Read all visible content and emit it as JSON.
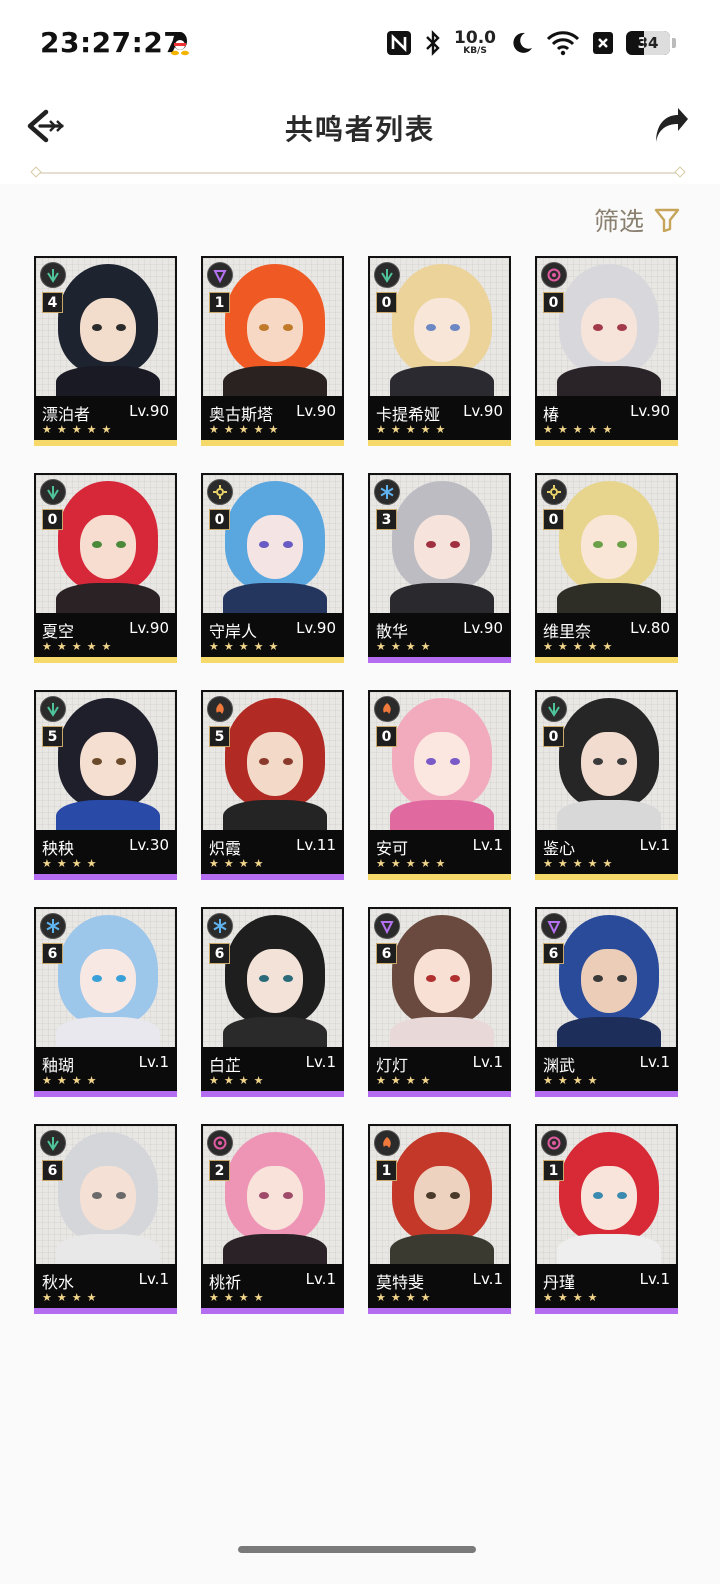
{
  "status_bar": {
    "time": "23:27:27",
    "net_speed_value": "10.0",
    "net_speed_unit": "KB/S",
    "battery": "34"
  },
  "header": {
    "title": "共鸣者列表",
    "back_icon": "back-arrow-icon",
    "share_icon": "share-icon"
  },
  "filter": {
    "label": "筛选",
    "icon": "filter-icon"
  },
  "colors": {
    "gold": "#f5d96a",
    "purple": "#b46cf0",
    "aero": "#4fc49a",
    "electro": "#b472f0",
    "glacio": "#5fb3f0",
    "spectro": "#e8d36a",
    "fusion": "#f07a3c",
    "havoc": "#e05aa0"
  },
  "characters": [
    {
      "name": "漂泊者",
      "level": "Lv.90",
      "chain": "4",
      "stars": "★★★★★",
      "rarity": "gold",
      "element": "aero",
      "hair": "#1e2330",
      "skin": "#f2dccb",
      "outfit": "#1a1a24",
      "eye": "#2b2b2b"
    },
    {
      "name": "奥古斯塔",
      "level": "Lv.90",
      "chain": "1",
      "stars": "★★★★★",
      "rarity": "gold",
      "element": "electro",
      "hair": "#ef5a24",
      "skin": "#f6d8c4",
      "outfit": "#2a2220",
      "eye": "#c07b2a"
    },
    {
      "name": "卡提希娅",
      "level": "Lv.90",
      "chain": "0",
      "stars": "★★★★★",
      "rarity": "gold",
      "element": "aero",
      "hair": "#ecd39a",
      "skin": "#f8e6d8",
      "outfit": "#2a2a30",
      "eye": "#6b87c4"
    },
    {
      "name": "椿",
      "level": "Lv.90",
      "chain": "0",
      "stars": "★★★★★",
      "rarity": "gold",
      "element": "havoc",
      "hair": "#d8d8dc",
      "skin": "#f6e4da",
      "outfit": "#2a2428",
      "eye": "#a33a4a"
    },
    {
      "name": "夏空",
      "level": "Lv.90",
      "chain": "0",
      "stars": "★★★★★",
      "rarity": "gold",
      "element": "aero",
      "hair": "#d7283a",
      "skin": "#f7ddd0",
      "outfit": "#2b2226",
      "eye": "#4a8a3a"
    },
    {
      "name": "守岸人",
      "level": "Lv.90",
      "chain": "0",
      "stars": "★★★★★",
      "rarity": "gold",
      "element": "spectro",
      "hair": "#5aa6de",
      "skin": "#f4e4e4",
      "outfit": "#24365e",
      "eye": "#6a5ac4"
    },
    {
      "name": "散华",
      "level": "Lv.90",
      "chain": "3",
      "stars": "★★★★",
      "rarity": "purple",
      "element": "glacio",
      "hair": "#bcbcc2",
      "skin": "#f6e4dc",
      "outfit": "#2a2a2e",
      "eye": "#a03040"
    },
    {
      "name": "维里奈",
      "level": "Lv.80",
      "chain": "0",
      "stars": "★★★★★",
      "rarity": "gold",
      "element": "spectro",
      "hair": "#e7d58e",
      "skin": "#f9e6d6",
      "outfit": "#2e2e26",
      "eye": "#6aa048"
    },
    {
      "name": "秧秧",
      "level": "Lv.30",
      "chain": "5",
      "stars": "★★★★",
      "rarity": "purple",
      "element": "aero",
      "hair": "#1f1f2c",
      "skin": "#f4dfd0",
      "outfit": "#2a4aa8",
      "eye": "#6a4a2a"
    },
    {
      "name": "炽霞",
      "level": "Lv.11",
      "chain": "5",
      "stars": "★★★★",
      "rarity": "purple",
      "element": "fusion",
      "hair": "#b22a24",
      "skin": "#f3d9c8",
      "outfit": "#242424",
      "eye": "#8a3a2a"
    },
    {
      "name": "安可",
      "level": "Lv.1",
      "chain": "0",
      "stars": "★★★★★",
      "rarity": "gold",
      "element": "fusion",
      "hair": "#f2aabd",
      "skin": "#fbe6e0",
      "outfit": "#e06aa0",
      "eye": "#7a5ac8"
    },
    {
      "name": "鉴心",
      "level": "Lv.1",
      "chain": "0",
      "stars": "★★★★★",
      "rarity": "gold",
      "element": "aero",
      "hair": "#262626",
      "skin": "#f2dcd0",
      "outfit": "#d8d8d8",
      "eye": "#3a3a3a"
    },
    {
      "name": "釉瑚",
      "level": "Lv.1",
      "chain": "6",
      "stars": "★★★★",
      "rarity": "purple",
      "element": "glacio",
      "hair": "#9cc6ea",
      "skin": "#f8e8e4",
      "outfit": "#e8e8ee",
      "eye": "#3aa0d8"
    },
    {
      "name": "白芷",
      "level": "Lv.1",
      "chain": "6",
      "stars": "★★★★",
      "rarity": "purple",
      "element": "glacio",
      "hair": "#1e1e1e",
      "skin": "#f3e2d8",
      "outfit": "#2a2a2a",
      "eye": "#2a6a7a"
    },
    {
      "name": "灯灯",
      "level": "Lv.1",
      "chain": "6",
      "stars": "★★★★",
      "rarity": "purple",
      "element": "electro",
      "hair": "#6a4a3e",
      "skin": "#f8e0d4",
      "outfit": "#e8d8d8",
      "eye": "#b03030"
    },
    {
      "name": "渊武",
      "level": "Lv.1",
      "chain": "6",
      "stars": "★★★★",
      "rarity": "purple",
      "element": "electro",
      "hair": "#2a4a9a",
      "skin": "#eccdb8",
      "outfit": "#1e2e5a",
      "eye": "#3a3a3a"
    },
    {
      "name": "秋水",
      "level": "Lv.1",
      "chain": "6",
      "stars": "★★★★",
      "rarity": "purple",
      "element": "aero",
      "hair": "#d4d6da",
      "skin": "#f4e0d4",
      "outfit": "#e8e8e8",
      "eye": "#6a6a6a"
    },
    {
      "name": "桃祈",
      "level": "Lv.1",
      "chain": "2",
      "stars": "★★★★",
      "rarity": "purple",
      "element": "havoc",
      "hair": "#ee95b6",
      "skin": "#f8e2da",
      "outfit": "#2a2226",
      "eye": "#a04a6a"
    },
    {
      "name": "莫特斐",
      "level": "Lv.1",
      "chain": "1",
      "stars": "★★★★",
      "rarity": "purple",
      "element": "fusion",
      "hair": "#c4382a",
      "skin": "#eed2c0",
      "outfit": "#3a3a30",
      "eye": "#4a3a2a"
    },
    {
      "name": "丹瑾",
      "level": "Lv.1",
      "chain": "1",
      "stars": "★★★★",
      "rarity": "purple",
      "element": "havoc",
      "hair": "#d82a36",
      "skin": "#f8e4da",
      "outfit": "#eeeeee",
      "eye": "#3a8ab0"
    }
  ]
}
